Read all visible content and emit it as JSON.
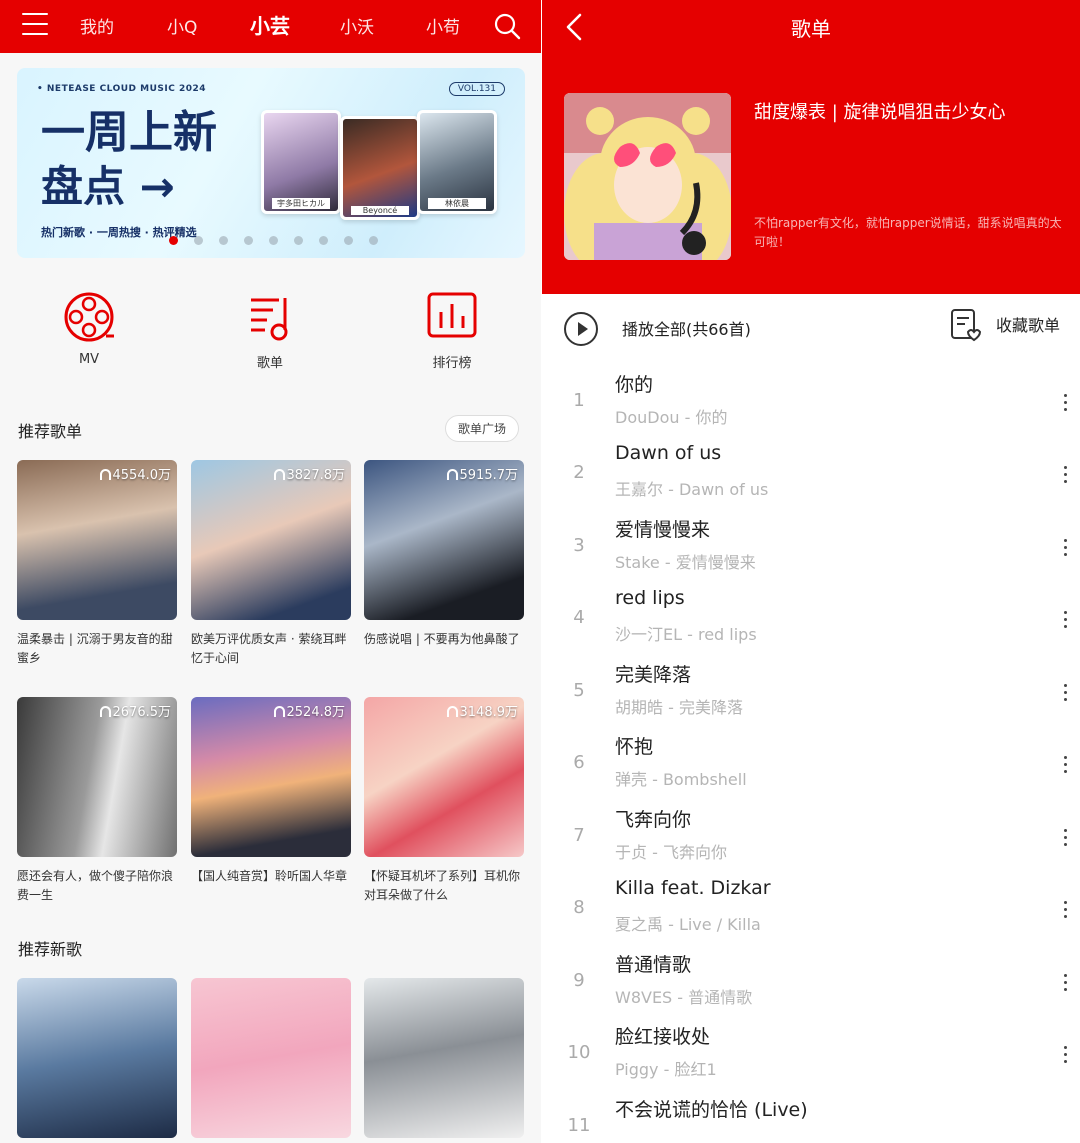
{
  "left": {
    "nav": {
      "tabs": [
        "我的",
        "小Q",
        "小芸",
        "小沃",
        "小苟"
      ],
      "active_index": 2
    },
    "banner": {
      "top_text": "• NETEASE CLOUD MUSIC 2024",
      "vol": "VOL.131",
      "headline_1": "一周上新",
      "headline_2": "盘点 →",
      "subline": "热门新歌 · 一周热搜 · 热评精选",
      "cards": [
        "宇多田ヒカル",
        "Beyoncé",
        "林依晨"
      ],
      "dot_count": 9,
      "active_dot": 0
    },
    "shortcuts": [
      {
        "label": "MV",
        "icon": "film-reel-icon"
      },
      {
        "label": "歌单",
        "icon": "playlist-icon"
      },
      {
        "label": "排行榜",
        "icon": "chart-icon"
      }
    ],
    "recommended_playlists": {
      "title": "推荐歌单",
      "square_button": "歌单广场",
      "items": [
        {
          "count": "4554.0万",
          "title": "温柔暴击 | 沉溺于男友音的甜蜜乡"
        },
        {
          "count": "3827.8万",
          "title": "欧美万评优质女声 · 萦绕耳畔忆于心间"
        },
        {
          "count": "5915.7万",
          "title": "伤感说唱 | 不要再为他鼻酸了"
        },
        {
          "count": "2676.5万",
          "title": "愿还会有人，做个傻子陪你浪费一生"
        },
        {
          "count": "2524.8万",
          "title": "【国人纯音赏】聆听国人华章"
        },
        {
          "count": "3148.9万",
          "title": "【怀疑耳机坏了系列】耳机你对耳朵做了什么"
        }
      ]
    },
    "new_songs": {
      "title": "推荐新歌"
    }
  },
  "right": {
    "title": "歌单",
    "playlist_name": "甜度爆表 | 旋律说唱狙击少女心",
    "description": "不怕rapper有文化，就怕rapper说情话，甜系说唱真的太可啦！",
    "play_all": "播放全部(共66首)",
    "collect": "收藏歌单",
    "songs": [
      {
        "no": "1",
        "title": "你的",
        "artist": "DouDou - 你的"
      },
      {
        "no": "2",
        "title": "Dawn of us",
        "artist": "王嘉尔 - Dawn of us"
      },
      {
        "no": "3",
        "title": "爱情慢慢来",
        "artist": "Stake - 爱情慢慢来"
      },
      {
        "no": "4",
        "title": "red lips",
        "artist": "沙一汀EL - red lips"
      },
      {
        "no": "5",
        "title": "完美降落",
        "artist": "胡期皓 - 完美降落"
      },
      {
        "no": "6",
        "title": "怀抱",
        "artist": "弹壳 - Bombshell"
      },
      {
        "no": "7",
        "title": "飞奔向你",
        "artist": "于贞 - 飞奔向你"
      },
      {
        "no": "8",
        "title": "Killa feat. Dizkar",
        "artist": "夏之禹 - Live / Killa"
      },
      {
        "no": "9",
        "title": "普通情歌",
        "artist": "W8VES - 普通情歌"
      },
      {
        "no": "10",
        "title": "脸红接收处",
        "artist": "Piggy - 脸红1"
      },
      {
        "no": "11",
        "title": "不会说谎的恰恰 (Live)",
        "artist": ""
      }
    ]
  },
  "colors": {
    "brand_red": "#e50000"
  }
}
